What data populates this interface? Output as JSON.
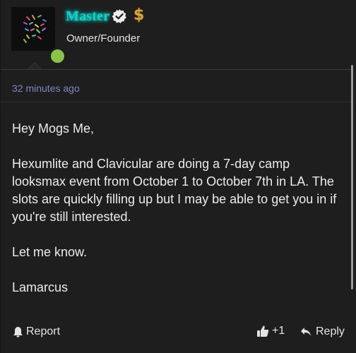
{
  "header": {
    "username": "Master",
    "user_title": "Owner/Founder",
    "username_color": "#1ec8c8",
    "status_color": "#8bc34a",
    "icons": [
      "verified-badge-icon",
      "dollar-icon"
    ],
    "dollar_glyph": "$"
  },
  "post": {
    "timestamp": "32 minutes ago",
    "greeting": "Hey Mogs Me,",
    "body": "Hexumlite and Clavicular are doing a 7-day camp looksmax event from October 1 to October 7th in LA. The slots are quickly filling up but I may be able to get you in if you're still interested.",
    "closing": "Let me know.",
    "signature": "Lamarcus"
  },
  "footer": {
    "report_label": "Report",
    "like_count": "+1",
    "reply_label": "Reply"
  },
  "colors": {
    "background": "#1e1e1e",
    "timestamp": "#7b86c7",
    "text": "#ececec"
  }
}
